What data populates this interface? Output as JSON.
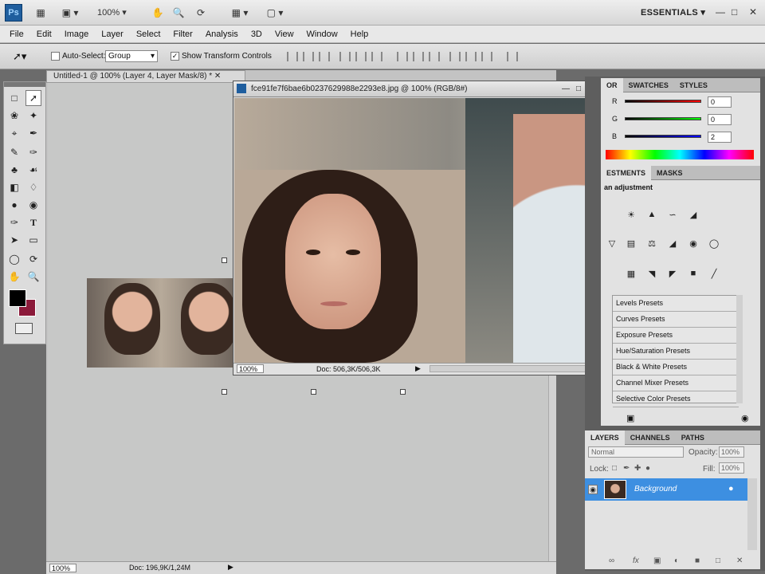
{
  "appbar": {
    "logo": "Ps",
    "zoom": "100%",
    "workspace": "ESSENTIALS",
    "minimize": "—",
    "restore": "□",
    "close": "✕"
  },
  "menu": [
    "File",
    "Edit",
    "Image",
    "Layer",
    "Select",
    "Filter",
    "Analysis",
    "3D",
    "View",
    "Window",
    "Help"
  ],
  "options": {
    "auto_select_label": "Auto-Select:",
    "auto_select_value": "Group",
    "show_transform_label": "Show Transform Controls"
  },
  "doc": {
    "tab_title": "Untitled-1 @ 100% (Layer 4, Layer Mask/8) *",
    "zoom": "100%",
    "status": "Doc: 196,9K/1,24M"
  },
  "floatwin": {
    "title": "fce91fe7f6bae6b0237629988e2293e8.jpg @ 100% (RGB/8#)",
    "zoom": "100%",
    "status": "Doc: 506,3K/506,3K"
  },
  "color_panel": {
    "tabs": [
      "OR",
      "SWATCHES",
      "STYLES"
    ],
    "rows": [
      {
        "label": "R",
        "value": "0"
      },
      {
        "label": "G",
        "value": "0"
      },
      {
        "label": "B",
        "value": "2"
      }
    ]
  },
  "adjust_panel": {
    "tabs": [
      "ESTMENTS",
      "MASKS"
    ],
    "heading": "an adjustment",
    "presets": [
      "Levels Presets",
      "Curves Presets",
      "Exposure Presets",
      "Hue/Saturation Presets",
      "Black & White Presets",
      "Channel Mixer Presets",
      "Selective Color Presets"
    ]
  },
  "layers_panel": {
    "tabs": [
      "LAYERS",
      "CHANNELS",
      "PATHS"
    ],
    "blend_mode": "Normal",
    "opacity_label": "Opacity:",
    "opacity": "100%",
    "lock_label": "Lock:",
    "fill_label": "Fill:",
    "fill": "100%",
    "layer_name": "Background"
  },
  "colors": {
    "accent": "#3d8fe1",
    "foreground": "#000000",
    "background": "#8b1a3a"
  }
}
